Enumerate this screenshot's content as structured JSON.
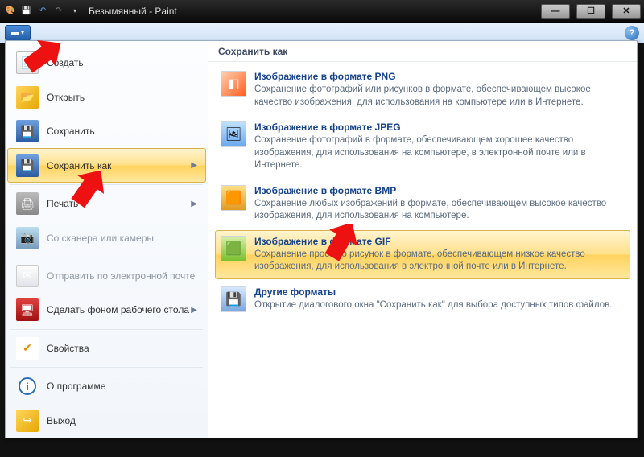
{
  "window": {
    "title": "Безымянный - Paint"
  },
  "left_menu": {
    "new_label": "Создать",
    "open_label": "Открыть",
    "save_label": "Сохранить",
    "saveas_label": "Сохранить как",
    "print_label": "Печать",
    "scan_label": "Со сканера или камеры",
    "mail_label": "Отправить по электронной почте",
    "desktop_label": "Сделать фоном рабочего стола",
    "properties_label": "Свойства",
    "about_label": "О программе",
    "exit_label": "Выход"
  },
  "right_panel": {
    "header": "Сохранить как",
    "items": [
      {
        "title": "Изображение в формате PNG",
        "desc": "Сохранение фотографий или рисунков в формате, обеспечивающем высокое качество изображения, для использования на компьютере или в Интернете."
      },
      {
        "title": "Изображение в формате JPEG",
        "desc": "Сохранение фотографий в формате, обеспечивающем хорошее качество изображения, для использования на компьютере, в электронной почте или в Интернете."
      },
      {
        "title": "Изображение в формате BMP",
        "desc": "Сохранение любых изображений в формате, обеспечивающем высокое качество изображения, для использования на компьютере."
      },
      {
        "title": "Изображение в формате GIF",
        "desc": "Сохранение простого рисунок в формате, обеспечивающем низкое качество изображения, для использования в электронной почте или в Интернете."
      },
      {
        "title": "Другие форматы",
        "desc": "Открытие диалогового окна \"Сохранить как\" для выбора доступных типов файлов."
      }
    ]
  }
}
